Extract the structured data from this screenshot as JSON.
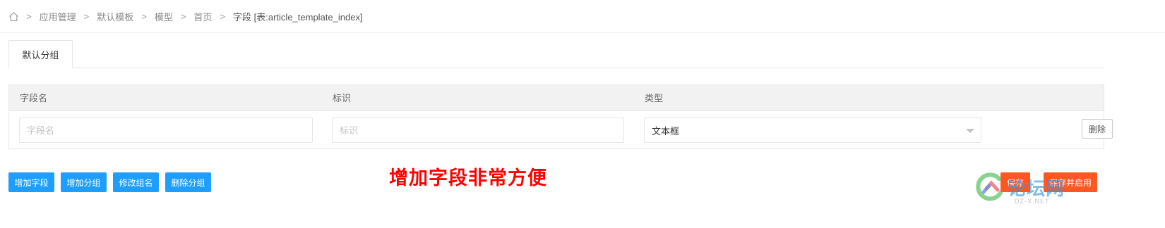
{
  "breadcrumb": {
    "items": [
      "应用管理",
      "默认模板",
      "模型",
      "首页",
      "字段 [表:article_template_index]"
    ],
    "separator": ">"
  },
  "tabs": [
    {
      "label": "默认分组"
    }
  ],
  "table": {
    "headers": {
      "name": "字段名",
      "ident": "标识",
      "type": "类型"
    },
    "row": {
      "name_placeholder": "字段名",
      "ident_placeholder": "标识",
      "type_value": "文本框",
      "delete_label": "删除"
    }
  },
  "actions": {
    "add_field": "增加字段",
    "add_group": "增加分组",
    "rename_group": "修改组名",
    "delete_group": "删除分组",
    "save": "保存",
    "save_enable": "保存并启用"
  },
  "promo_text": "增加字段非常方便",
  "watermark": {
    "text": "论坛网",
    "sub": "DZ-X.NET"
  },
  "colors": {
    "primary": "#1e9fff",
    "warn": "#ff5722",
    "promo": "#ff0000"
  }
}
